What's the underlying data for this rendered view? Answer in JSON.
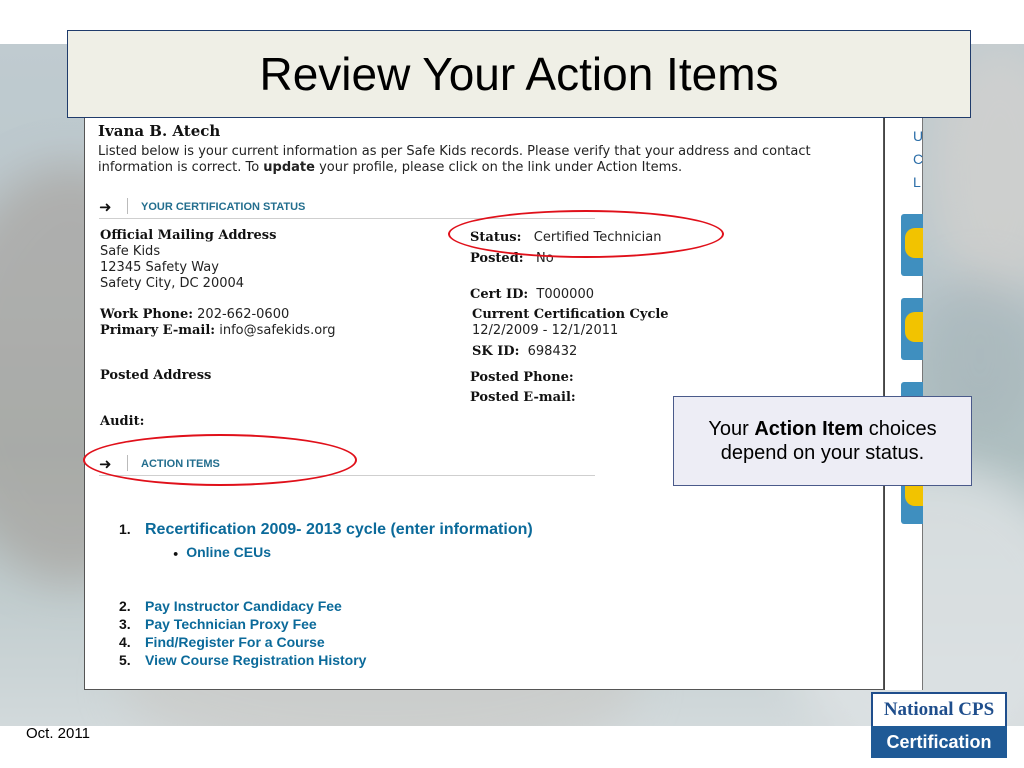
{
  "slide": {
    "title": "Review Your Action Items",
    "date": "Oct. 2011",
    "callout": {
      "prefix": "Your ",
      "emphasis": "Action Item",
      "suffix": " choices depend on your status."
    },
    "logo": {
      "line1": "National CPS",
      "line2": "Certification"
    }
  },
  "profile": {
    "name": "Ivana B. Atech",
    "intro_part1": "Listed below is your current information as per Safe Kids records. Please verify that your address and contact information is correct. To ",
    "intro_bold": "update",
    "intro_part2": " your profile, please click on the link under Action Items.",
    "cert_section": "YOUR CERTIFICATION STATUS",
    "mailing_label": "Official Mailing Address",
    "mailing_lines": [
      "Safe Kids",
      "12345 Safety Way",
      "Safety City, DC 20004"
    ],
    "work_phone_label": "Work Phone:",
    "work_phone": "202-662-0600",
    "email_label": "Primary E-mail:",
    "email": "info@safekids.org",
    "posted_address_label": "Posted Address",
    "audit_label": "Audit:",
    "status_label": "Status:",
    "status_value": "Certified Technician",
    "posted_label": "Posted:",
    "posted_value": "No",
    "cert_id_label": "Cert ID:",
    "cert_id": "T000000",
    "cycle_label": "Current Certification Cycle",
    "cycle_value": "12/2/2009 - 12/1/2011",
    "sk_id_label": "SK ID:",
    "sk_id": "698432",
    "posted_phone_label": "Posted Phone:",
    "posted_email_label": "Posted E-mail:",
    "action_section": "ACTION ITEMS",
    "actions": [
      {
        "num": "1.",
        "label": "Recertification 2009- 2013 cycle (enter information)"
      },
      {
        "num": "2.",
        "label": "Pay Instructor Candidacy Fee"
      },
      {
        "num": "3.",
        "label": "Pay Technician Proxy Fee"
      },
      {
        "num": "4.",
        "label": "Find/Register For a Course"
      },
      {
        "num": "5.",
        "label": "View Course Registration History"
      }
    ],
    "sub_action": "Online CEUs"
  },
  "sidebar_letters": [
    "U",
    "C",
    "L"
  ],
  "colors": {
    "link": "#0b6a9a",
    "highlight": "#e0101a",
    "title_bg": "#efefe6",
    "logo": "#1f5a96"
  }
}
